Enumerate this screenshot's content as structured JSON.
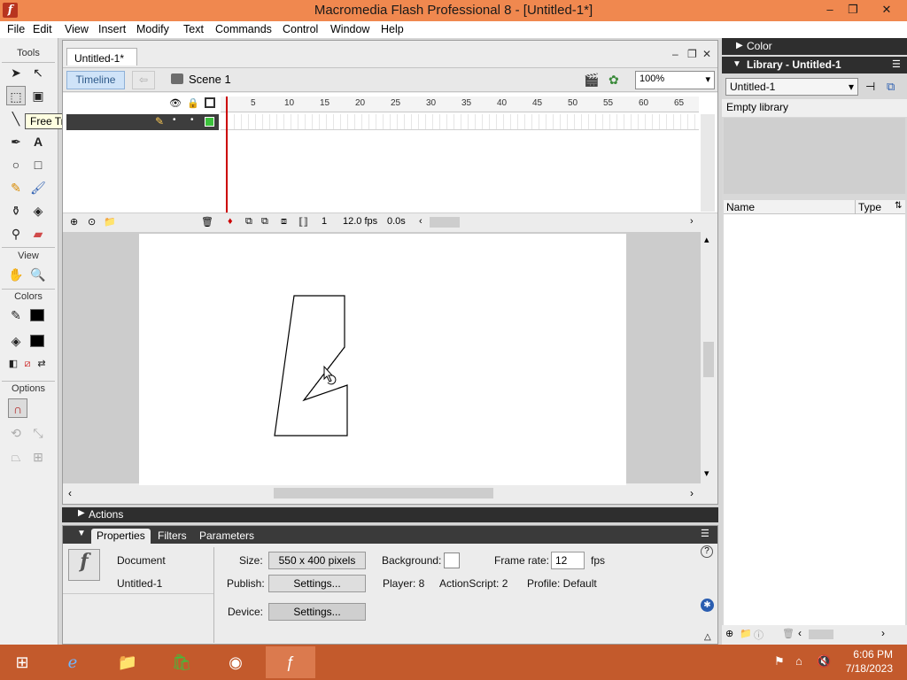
{
  "window": {
    "title": "Macromedia Flash Professional 8 - [Untitled-1*]",
    "minimize": "–",
    "restore": "❐",
    "close": "✕"
  },
  "menu": [
    "File",
    "Edit",
    "View",
    "Insert",
    "Modify",
    "Text",
    "Commands",
    "Control",
    "Window",
    "Help"
  ],
  "tools": {
    "title": "Tools",
    "view_label": "View",
    "colors_label": "Colors",
    "options_label": "Options",
    "tooltip": "Free Transform Tool (Q)"
  },
  "document": {
    "tab": "Untitled-1*",
    "timeline_btn": "Timeline",
    "scene": "Scene 1",
    "zoom": "100%"
  },
  "timeline": {
    "ruler": [
      "5",
      "10",
      "15",
      "20",
      "25",
      "30",
      "35",
      "40",
      "45",
      "50",
      "55",
      "60",
      "65"
    ],
    "current_frame": "1",
    "fps": "12.0 fps",
    "time": "0.0s"
  },
  "actions_label": "Actions",
  "properties": {
    "tabs": [
      "Properties",
      "Filters",
      "Parameters"
    ],
    "doc_label": "Document",
    "doc_name": "Untitled-1",
    "size_label": "Size:",
    "size_value": "550 x 400 pixels",
    "background_label": "Background:",
    "framerate_label": "Frame rate:",
    "framerate_value": "12",
    "fps_unit": "fps",
    "publish_label": "Publish:",
    "settings_btn": "Settings...",
    "player": "Player: 8",
    "actionscript": "ActionScript:  2",
    "profile": "Profile:  Default",
    "device_label": "Device:",
    "device_btn": "Settings..."
  },
  "right_panels": {
    "color_title": "Color",
    "library_title": "Library - Untitled-1",
    "library_select": "Untitled-1",
    "empty_text": "Empty library",
    "col_name": "Name",
    "col_type": "Type"
  },
  "taskbar": {
    "time": "6:06 PM",
    "date": "7/18/2023"
  },
  "colors": {
    "titlebar": "#f0884f",
    "taskbar": "#c35a2c",
    "playhead": "#cc0000"
  }
}
